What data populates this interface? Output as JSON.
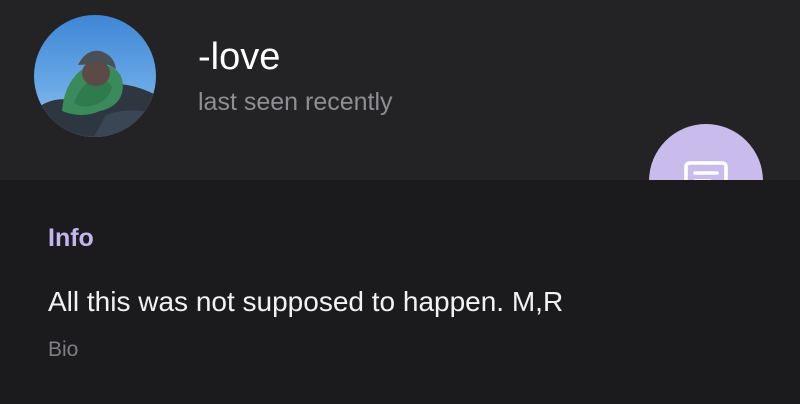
{
  "profile": {
    "name": "-love",
    "status": "last seen recently",
    "avatar_icon": "profile-photo"
  },
  "actions": {
    "message_icon": "message-icon"
  },
  "info": {
    "heading": "Info",
    "bio_text": "All this was not supposed to happen. M,R",
    "bio_label": "Bio"
  },
  "colors": {
    "header_bg": "#232325",
    "body_bg": "#1b1b1d",
    "accent": "#c9bbec",
    "heading": "#c4b4f0"
  }
}
